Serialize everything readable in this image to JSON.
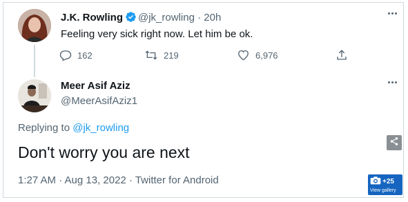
{
  "tweet": {
    "author_name": "J.K. Rowling",
    "handle": "@jk_rowling",
    "separator": " · ",
    "time": "20h",
    "text": "Feeling very sick right now. Let him be ok.",
    "replies": "162",
    "retweets": "219",
    "likes": "6,976",
    "verified": true
  },
  "reply": {
    "author_name": "Meer Asif Aziz",
    "handle": "@MeerAsifAziz1",
    "replying_prefix": "Replying to ",
    "replying_to": "@jk_rowling",
    "text": "Don't worry you are next",
    "timestamp": "1:27 AM · Aug 13, 2022 · Twitter for Android"
  },
  "gallery_badge": {
    "count": "+25",
    "label": "View gallery"
  },
  "icons": {
    "more": "more-horizontal-icon",
    "reply": "reply-icon",
    "retweet": "retweet-icon",
    "like": "heart-icon",
    "share": "share-icon",
    "verified": "verified-badge-icon",
    "camera": "camera-icon"
  },
  "colors": {
    "accent": "#1d9bf0",
    "muted": "#536471",
    "text": "#0f1419",
    "gallery_bg": "#1565c0"
  }
}
